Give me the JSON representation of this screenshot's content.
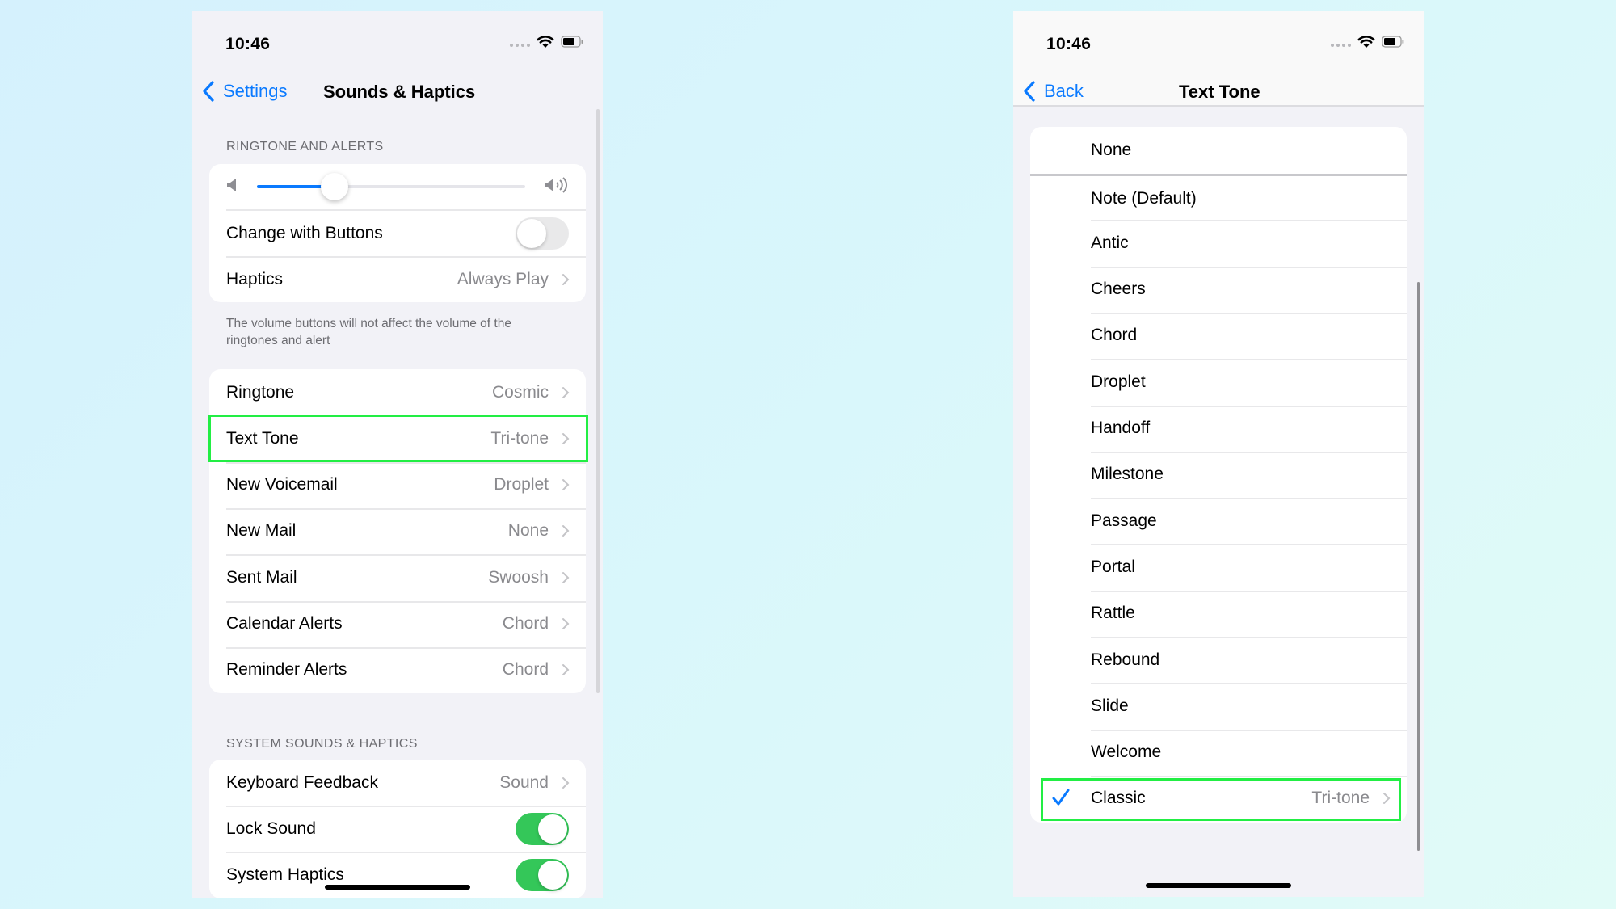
{
  "colors": {
    "accent": "#0a7aff",
    "toggle_on": "#34c759",
    "highlight": "#22ee44",
    "secondary_text": "#8a8a8e",
    "group_background": "#f2f2f7"
  },
  "left_screen": {
    "status_bar": {
      "time": "10:46",
      "icons": [
        "signal-dots-icon",
        "wifi-icon",
        "battery-icon"
      ]
    },
    "nav": {
      "back_label": "Settings",
      "title": "Sounds & Haptics"
    },
    "ringtone_section": {
      "header": "RINGTONE AND ALERTS",
      "volume_slider": {
        "value": 0.29,
        "min_icon": "speaker-icon",
        "max_icon": "speaker-wave-icon"
      },
      "change_with_buttons": {
        "label": "Change with Buttons",
        "on": false
      },
      "haptics": {
        "label": "Haptics",
        "value": "Always Play"
      },
      "footer": "The volume buttons will not affect the volume of the ringtones and alert"
    },
    "sounds_section": {
      "rows": [
        {
          "label": "Ringtone",
          "value": "Cosmic"
        },
        {
          "label": "Text Tone",
          "value": "Tri-tone",
          "highlighted": true
        },
        {
          "label": "New Voicemail",
          "value": "Droplet"
        },
        {
          "label": "New Mail",
          "value": "None"
        },
        {
          "label": "Sent Mail",
          "value": "Swoosh"
        },
        {
          "label": "Calendar Alerts",
          "value": "Chord"
        },
        {
          "label": "Reminder Alerts",
          "value": "Chord"
        }
      ]
    },
    "system_section": {
      "header": "SYSTEM SOUNDS & HAPTICS",
      "keyboard_feedback": {
        "label": "Keyboard Feedback",
        "value": "Sound"
      },
      "lock_sound": {
        "label": "Lock Sound",
        "on": true
      },
      "system_haptics": {
        "label": "System Haptics",
        "on": true
      }
    }
  },
  "right_screen": {
    "status_bar": {
      "time": "10:46",
      "icons": [
        "signal-dots-icon",
        "wifi-icon",
        "battery-icon"
      ]
    },
    "nav": {
      "back_label": "Back",
      "title": "Text Tone"
    },
    "tones": [
      {
        "label": "None"
      },
      {
        "label": "Note (Default)"
      },
      {
        "label": "Antic"
      },
      {
        "label": "Cheers"
      },
      {
        "label": "Chord"
      },
      {
        "label": "Droplet"
      },
      {
        "label": "Handoff"
      },
      {
        "label": "Milestone"
      },
      {
        "label": "Passage"
      },
      {
        "label": "Portal"
      },
      {
        "label": "Rattle"
      },
      {
        "label": "Rebound"
      },
      {
        "label": "Slide"
      },
      {
        "label": "Welcome"
      },
      {
        "label": "Classic",
        "value": "Tri-tone",
        "selected": true,
        "highlighted": true
      }
    ]
  }
}
